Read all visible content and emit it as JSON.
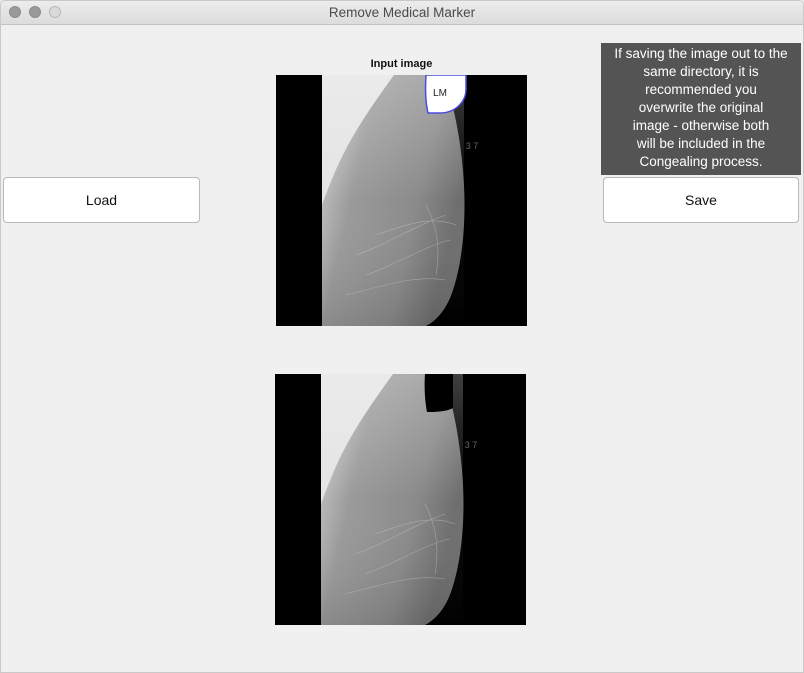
{
  "window": {
    "title": "Remove Medical Marker"
  },
  "controls": {
    "load_label": "Load",
    "save_label": "Save"
  },
  "tooltip": {
    "lines": [
      "If saving the image out to the",
      "same directory, it is",
      "recommended you",
      "overwrite the original",
      "image - otherwise both",
      "will be included in the",
      "Congealing process."
    ]
  },
  "input_panel": {
    "title": "Input image",
    "marker_text": "LM",
    "mirrored_label": "3 7"
  },
  "output_panel": {
    "mirrored_label": "3 7"
  },
  "colors": {
    "tooltip_bg": "#545454",
    "marker_outline": "#4a4adf",
    "window_bg": "#f0f0f0"
  }
}
